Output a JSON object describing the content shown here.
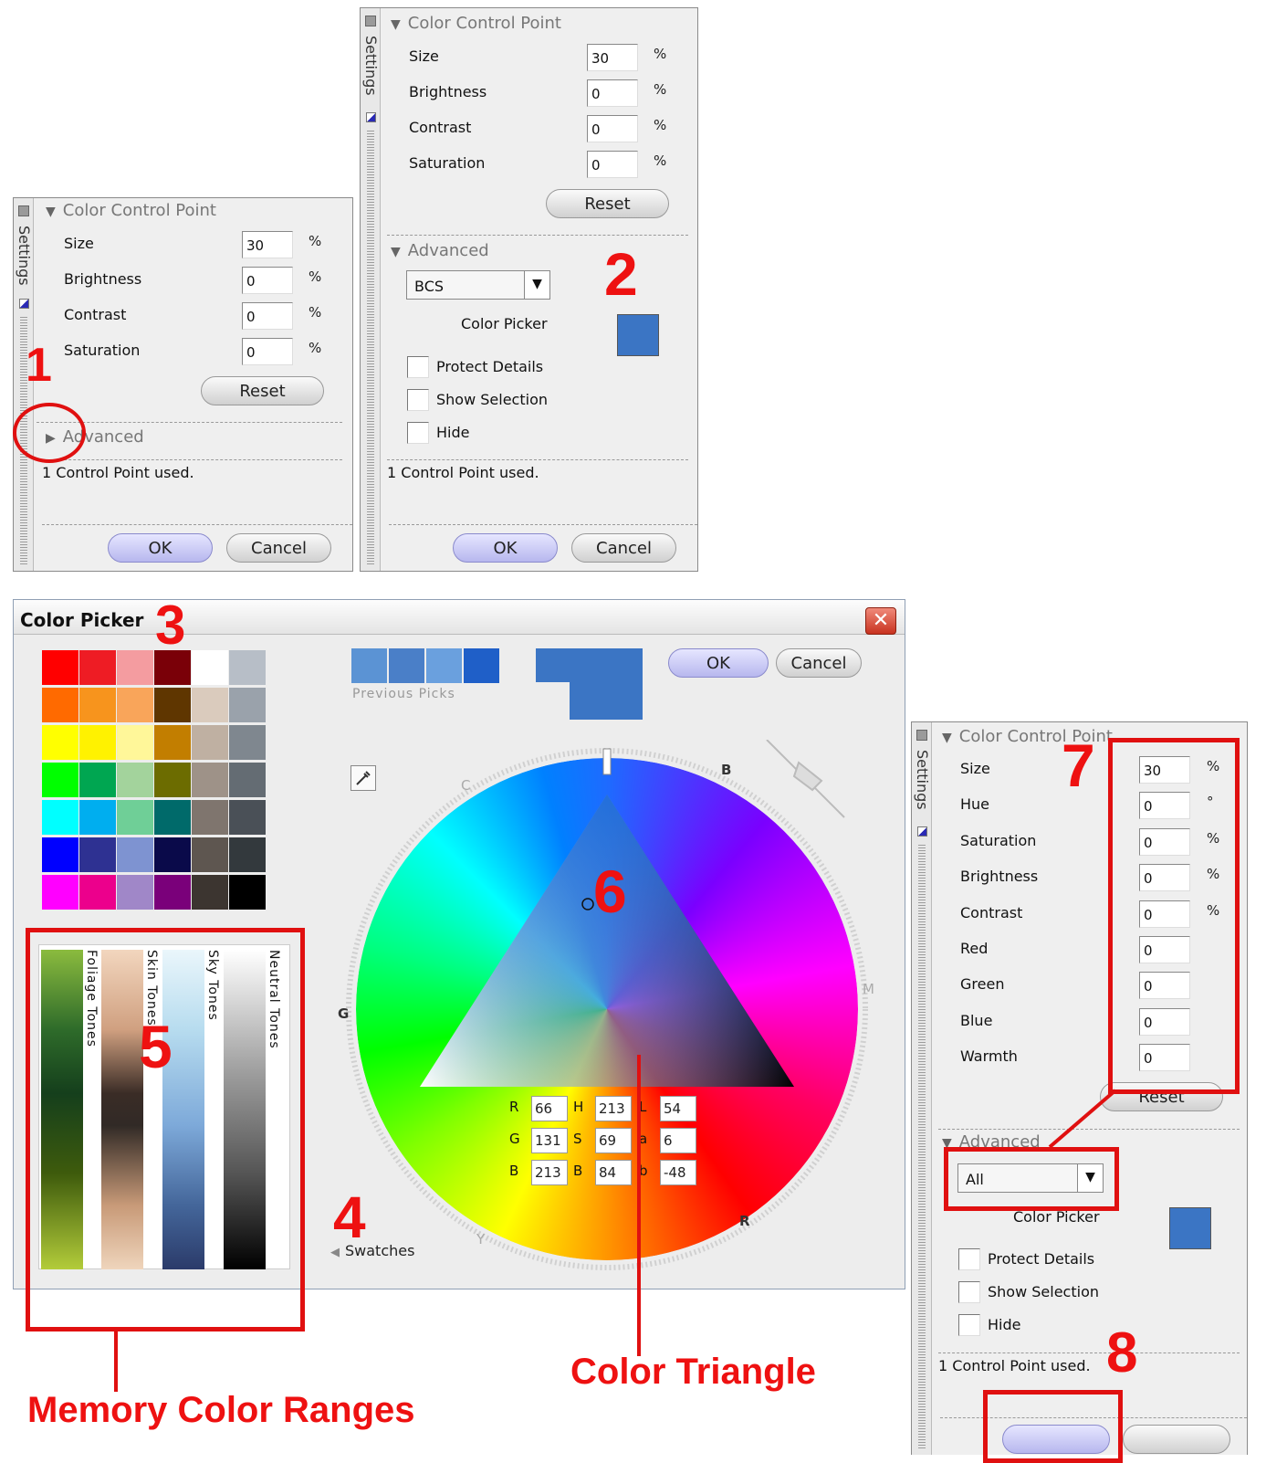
{
  "panel1": {
    "strip_label": "Settings",
    "section_title": "Color Control Point",
    "rows": [
      {
        "label": "Size",
        "value": "30",
        "unit": "%"
      },
      {
        "label": "Brightness",
        "value": "0",
        "unit": "%"
      },
      {
        "label": "Contrast",
        "value": "0",
        "unit": "%"
      },
      {
        "label": "Saturation",
        "value": "0",
        "unit": "%"
      }
    ],
    "reset": "Reset",
    "advanced": "Advanced",
    "status": "1 Control Point used.",
    "ok": "OK",
    "cancel": "Cancel"
  },
  "panel2": {
    "strip_label": "Settings",
    "section_title": "Color Control Point",
    "rows": [
      {
        "label": "Size",
        "value": "30",
        "unit": "%"
      },
      {
        "label": "Brightness",
        "value": "0",
        "unit": "%"
      },
      {
        "label": "Contrast",
        "value": "0",
        "unit": "%"
      },
      {
        "label": "Saturation",
        "value": "0",
        "unit": "%"
      }
    ],
    "reset": "Reset",
    "advanced": "Advanced",
    "mode": "BCS",
    "color_picker": "Color Picker",
    "swatch_color": "#3b75c4",
    "checks": [
      "Protect Details",
      "Show Selection",
      "Hide"
    ],
    "status": "1 Control Point used.",
    "ok": "OK",
    "cancel": "Cancel"
  },
  "picker": {
    "title": "Color Picker",
    "ok": "OK",
    "cancel": "Cancel",
    "previous_picks_label": "Previous Picks",
    "previous_picks": [
      "#5b93d4",
      "#4a7fc8",
      "#6aa0de",
      "#1f5fc8"
    ],
    "current_color": "#3b75c4",
    "swatch_grid": [
      [
        "#ff0000",
        "#ee1c24",
        "#f49ca0",
        "#7a0008",
        "#ffffff",
        "#b7bec7"
      ],
      [
        "#ff6a00",
        "#f7941d",
        "#f9a55a",
        "#5f3600",
        "#dacbbd",
        "#9aa2ab"
      ],
      [
        "#ffff00",
        "#fff200",
        "#fff799",
        "#c27e00",
        "#bfb0a2",
        "#7f878f"
      ],
      [
        "#00ff00",
        "#00a651",
        "#a3d39c",
        "#6c6c00",
        "#9e9288",
        "#646c73"
      ],
      [
        "#00ffff",
        "#00aeef",
        "#6fcf97",
        "#006a6a",
        "#7f756e",
        "#4a5057"
      ],
      [
        "#0000ff",
        "#2e3192",
        "#7e93d1",
        "#0a0a4a",
        "#5e5650",
        "#33393d"
      ],
      [
        "#ff00ff",
        "#ec008c",
        "#a087c8",
        "#7a007a",
        "#3c3530",
        "#000000"
      ]
    ],
    "ranges": [
      "Foliage Tones",
      "Skin Tones",
      "Sky Tones",
      "Neutral Tones"
    ],
    "swatches_toggle": "Swatches",
    "wheel_letters": [
      "C",
      "B",
      "G",
      "M",
      "Y",
      "R"
    ],
    "values": {
      "rgb": [
        {
          "k": "R",
          "v": "66"
        },
        {
          "k": "G",
          "v": "131"
        },
        {
          "k": "B",
          "v": "213"
        }
      ],
      "hsb": [
        {
          "k": "H",
          "v": "213"
        },
        {
          "k": "S",
          "v": "69"
        },
        {
          "k": "B",
          "v": "84"
        }
      ],
      "lab": [
        {
          "k": "L",
          "v": "54"
        },
        {
          "k": "a",
          "v": "6"
        },
        {
          "k": "b",
          "v": "-48"
        }
      ]
    }
  },
  "panel3": {
    "strip_label": "Settings",
    "section_title": "Color Control Point",
    "rows": [
      {
        "label": "Size",
        "value": "30",
        "unit": "%"
      },
      {
        "label": "Hue",
        "value": "0",
        "unit": "°"
      },
      {
        "label": "Saturation",
        "value": "0",
        "unit": "%"
      },
      {
        "label": "Brightness",
        "value": "0",
        "unit": "%"
      },
      {
        "label": "Contrast",
        "value": "0",
        "unit": "%"
      },
      {
        "label": "Red",
        "value": "0",
        "unit": ""
      },
      {
        "label": "Green",
        "value": "0",
        "unit": ""
      },
      {
        "label": "Blue",
        "value": "0",
        "unit": ""
      },
      {
        "label": "Warmth",
        "value": "0",
        "unit": ""
      }
    ],
    "reset": "Reset",
    "advanced": "Advanced",
    "mode": "All",
    "color_picker": "Color Picker",
    "swatch_color": "#3b75c4",
    "checks": [
      "Protect Details",
      "Show Selection",
      "Hide"
    ],
    "status": "1 Control Point used."
  },
  "annotations": {
    "n1": "1",
    "n2": "2",
    "n3": "3",
    "n4": "4",
    "n5": "5",
    "n6": "6",
    "n7": "7",
    "n8": "8",
    "memory": "Memory Color Ranges",
    "triangle": "Color Triangle",
    "accent": "#e01010"
  }
}
